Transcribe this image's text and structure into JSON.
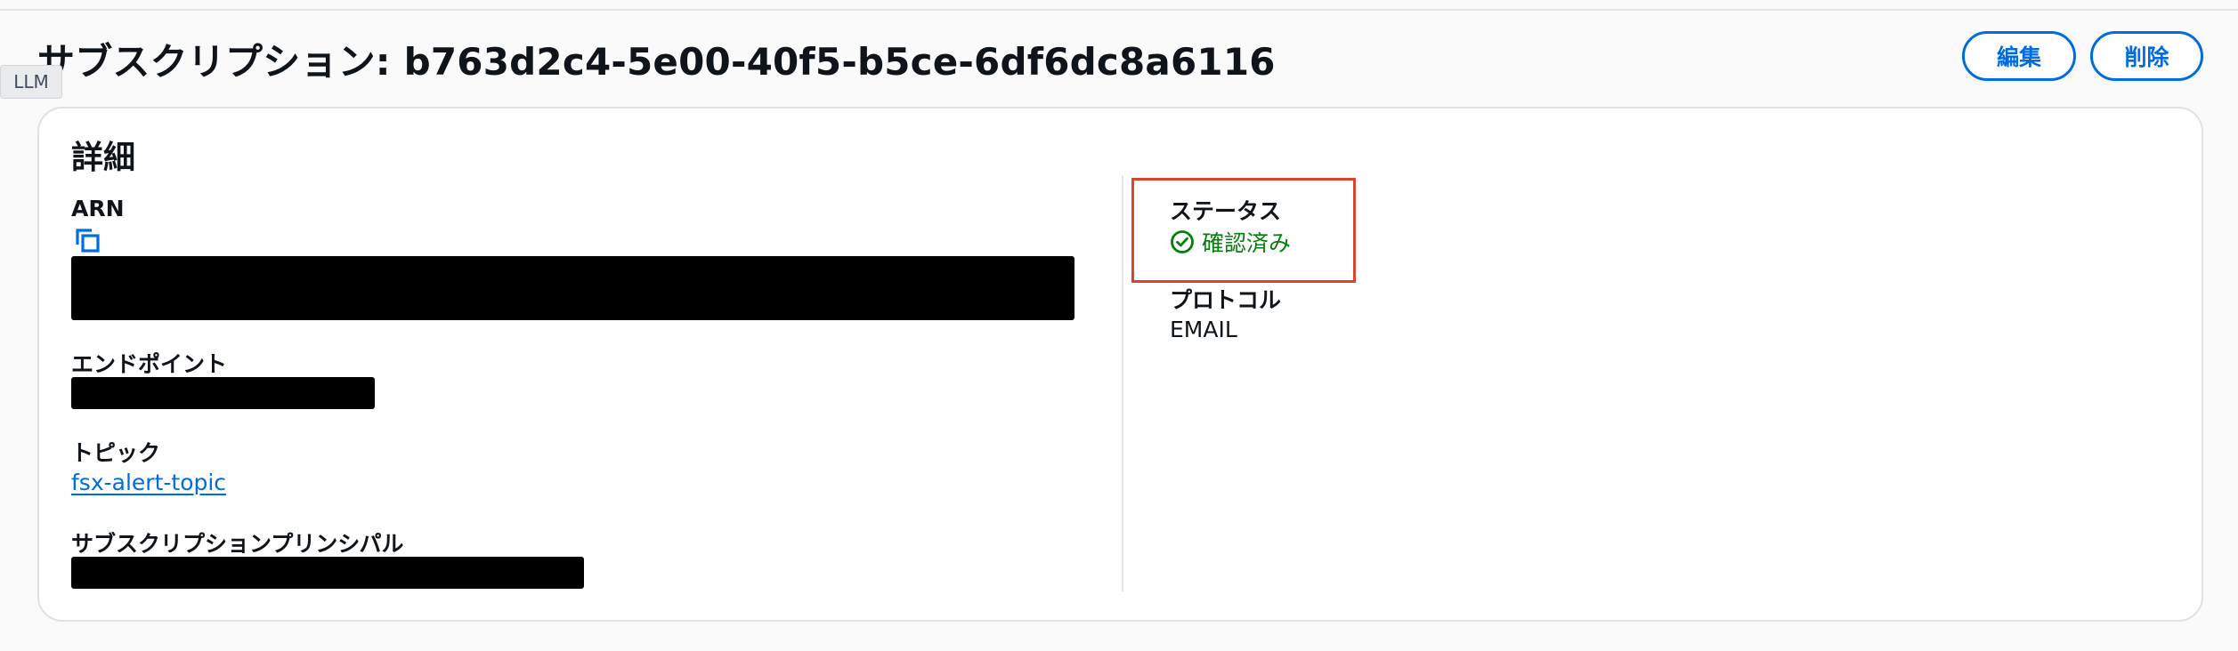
{
  "page": {
    "title": "サブスクリプション: b763d2c4-5e00-40f5-b5ce-6df6dc8a6116",
    "tooltip": "LLM",
    "actions": {
      "edit_label": "編集",
      "delete_label": "削除"
    }
  },
  "details": {
    "title": "詳細",
    "arn_label": "ARN",
    "endpoint_label": "エンドポイント",
    "topic_label": "トピック",
    "topic_value": "fsx-alert-topic",
    "principal_label": "サブスクリプションプリンシパル",
    "status_label": "ステータス",
    "status_value": "確認済み",
    "protocol_label": "プロトコル",
    "protocol_value": "EMAIL"
  },
  "icons": {
    "copy": "copy-icon",
    "status": "check-circle-icon"
  },
  "colors": {
    "primary": "#006ce0",
    "success": "#037f0c",
    "highlight": "#d7452c",
    "redaction": "#000000"
  }
}
